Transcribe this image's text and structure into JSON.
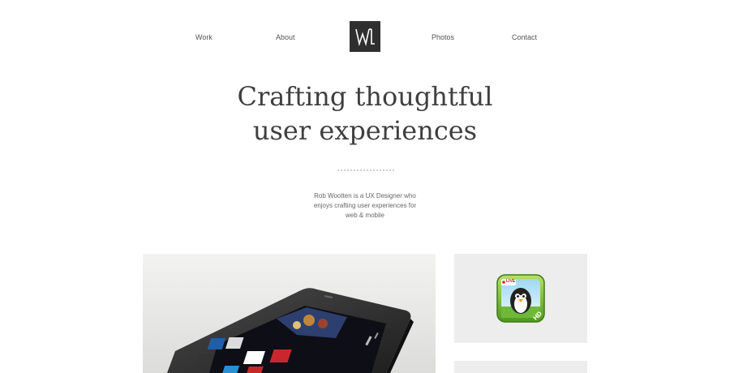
{
  "nav": {
    "items": [
      {
        "label": "Work"
      },
      {
        "label": "About"
      },
      {
        "label": "Photos"
      },
      {
        "label": "Contact"
      }
    ]
  },
  "logo": {
    "icon": "rw-monogram-icon"
  },
  "hero": {
    "headline_line1": "Crafting thoughtful",
    "headline_line2": "user experiences",
    "intro_line1": "Rob Wootten is a UX Designer who",
    "intro_line2": "enjoys crafting user experiences for",
    "intro_line3": "web & mobile"
  },
  "portfolio": {
    "tiles": [
      {
        "icon": "phone-mockup-image"
      },
      {
        "icon": "penguin-app-icon",
        "badge": "LIVE",
        "corner": "HD"
      },
      {
        "icon": "portfolio-tile"
      }
    ]
  }
}
